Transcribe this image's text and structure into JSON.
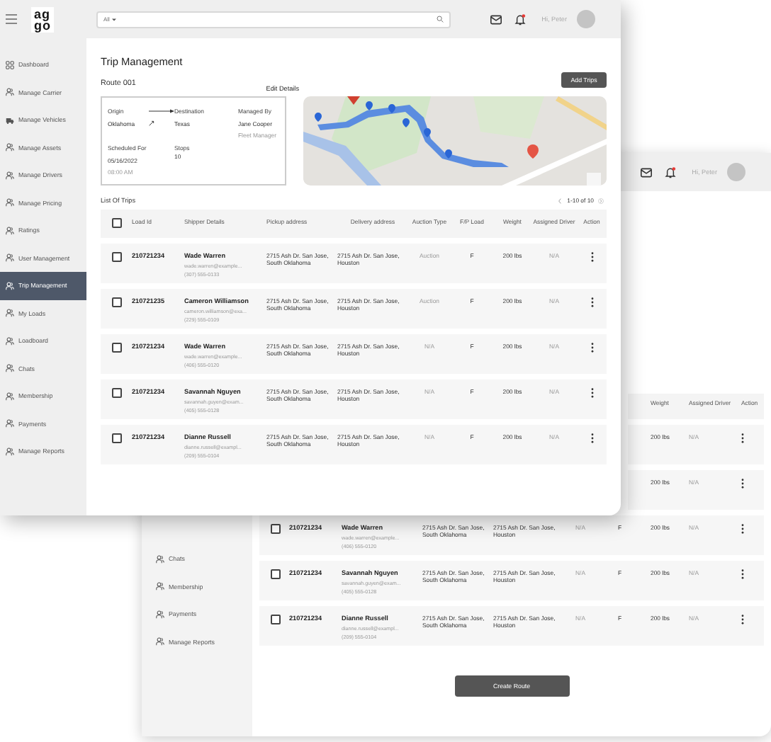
{
  "front_window": {
    "header": {
      "logo": [
        "ag",
        "go"
      ],
      "search": {
        "scope": "All"
      },
      "notifications": {
        "unread": true
      },
      "greeting": "Hi, Peter"
    },
    "sidebar": {
      "items": [
        {
          "label": "Dashboard",
          "selected": false
        },
        {
          "label": "Manage Carrier",
          "selected": false
        },
        {
          "label": "Manage Vehicles",
          "selected": false
        },
        {
          "label": "Manage Assets",
          "selected": false
        },
        {
          "label": "Manage Drivers",
          "selected": false
        },
        {
          "label": "Manage Pricing",
          "selected": false
        },
        {
          "label": "Ratings",
          "selected": false
        },
        {
          "label": "User Management",
          "selected": false
        },
        {
          "label": "Trip Management",
          "selected": true
        },
        {
          "label": "My Loads",
          "selected": false
        },
        {
          "label": "Loadboard",
          "selected": false
        },
        {
          "label": "Chats",
          "selected": false
        },
        {
          "label": "Membership",
          "selected": false
        },
        {
          "label": "Payments",
          "selected": false
        },
        {
          "label": "Manage Reports",
          "selected": false
        }
      ]
    },
    "page": {
      "title": "Trip Management",
      "route": "Route 001",
      "edit_link": "Edit Details",
      "add_button": "Add Trips",
      "summary": {
        "origin_label": "Origin",
        "destination_label": "Destination",
        "managed_by_label": "Managed By",
        "origin": "Oklahoma",
        "destination": "Texas",
        "manager": "Jane Cooper",
        "manager_role": "Fleet Manager",
        "scheduled_label": "Scheduled For",
        "stops_label": "Stops",
        "date": "05/16/2022",
        "time": "08:00 AM",
        "stops": "10"
      },
      "list_title": "List Of Trips",
      "pager": "1-10 of 10",
      "table": {
        "header_checked": false,
        "columns": [
          "Load Id",
          "Shipper Details",
          "Pickup address",
          "Delivery address",
          "Auction Type",
          "F/P Load",
          "Weight",
          "Assigned Driver",
          "Action"
        ],
        "rows": [
          {
            "checked": false,
            "load_id": "210721234",
            "name": "Wade Warren",
            "email": "wade.warren@example...",
            "phone": "(307) 555-0133",
            "pickup": "2715 Ash Dr. San Jose, South Oklahoma",
            "delivery": "2715 Ash Dr. San Jose, Houston",
            "auction": "Auction",
            "fp": "F",
            "weight": "200 lbs",
            "driver": "N/A"
          },
          {
            "checked": false,
            "load_id": "210721235",
            "name": "Cameron Williamson",
            "email": "cameron.williamson@exa...",
            "phone": "(229) 555-0109",
            "pickup": "2715 Ash Dr. San Jose, South Oklahoma",
            "delivery": "2715 Ash Dr. San Jose, Houston",
            "auction": "Auction",
            "fp": "F",
            "weight": "200 lbs",
            "driver": "N/A"
          },
          {
            "checked": false,
            "load_id": "210721234",
            "name": "Wade Warren",
            "email": "wade.warren@example...",
            "phone": "(406) 555-0120",
            "pickup": "2715 Ash Dr. San Jose, South Oklahoma",
            "delivery": "2715 Ash Dr. San Jose, Houston",
            "auction": "N/A",
            "fp": "F",
            "weight": "200 lbs",
            "driver": "N/A"
          },
          {
            "checked": false,
            "load_id": "210721234",
            "name": "Savannah Nguyen",
            "email": "savannah.guyen@exam...",
            "phone": "(405) 555-0128",
            "pickup": "2715 Ash Dr. San Jose, South Oklahoma",
            "delivery": "2715 Ash Dr. San Jose, Houston",
            "auction": "N/A",
            "fp": "F",
            "weight": "200 lbs",
            "driver": "N/A"
          },
          {
            "checked": false,
            "load_id": "210721234",
            "name": "Dianne Russell",
            "email": "dianne.russell@exampl...",
            "phone": "(209) 555-0104",
            "pickup": "2715 Ash Dr. San Jose, South Oklahoma",
            "delivery": "2715 Ash Dr. San Jose, Houston",
            "auction": "N/A",
            "fp": "F",
            "weight": "200 lbs",
            "driver": "N/A"
          }
        ]
      }
    }
  },
  "back_window": {
    "header": {
      "notifications": {
        "unread": true
      },
      "greeting": "Hi, Peter"
    },
    "sidebar": {
      "items": [
        {
          "label": "Chats",
          "selected": false
        },
        {
          "label": "Membership",
          "selected": false
        },
        {
          "label": "Payments",
          "selected": false
        },
        {
          "label": "Manage Reports",
          "selected": false
        }
      ]
    },
    "table": {
      "columns": {
        "weight": "Weight",
        "driver": "Assigned Driver",
        "action": "Action"
      },
      "rows": [
        {
          "weight": "200 lbs",
          "driver": "N/A"
        },
        {
          "weight": "200 lbs",
          "driver": "N/A"
        },
        {
          "checked": false,
          "load_id": "210721234",
          "name": "Wade Warren",
          "email": "wade.warren@example...",
          "phone": "(406) 555-0120",
          "pickup": "2715 Ash Dr. San Jose, South Oklahoma",
          "delivery": "2715 Ash Dr. San Jose, Houston",
          "auction": "N/A",
          "fp": "F",
          "weight": "200 lbs",
          "driver": "N/A"
        },
        {
          "checked": false,
          "load_id": "210721234",
          "name": "Savannah Nguyen",
          "email": "savannah.guyen@exam...",
          "phone": "(405) 555-0128",
          "pickup": "2715 Ash Dr. San Jose, South Oklahoma",
          "delivery": "2715 Ash Dr. San Jose, Houston",
          "auction": "N/A",
          "fp": "F",
          "weight": "200 lbs",
          "driver": "N/A"
        },
        {
          "checked": false,
          "load_id": "210721234",
          "name": "Dianne Russell",
          "email": "dianne.russell@exampl...",
          "phone": "(209) 555-0104",
          "pickup": "2715 Ash Dr. San Jose, South Oklahoma",
          "delivery": "2715 Ash Dr. San Jose, Houston",
          "auction": "N/A",
          "fp": "F",
          "weight": "200 lbs",
          "driver": "N/A"
        }
      ]
    },
    "create_button": "Create Route"
  }
}
